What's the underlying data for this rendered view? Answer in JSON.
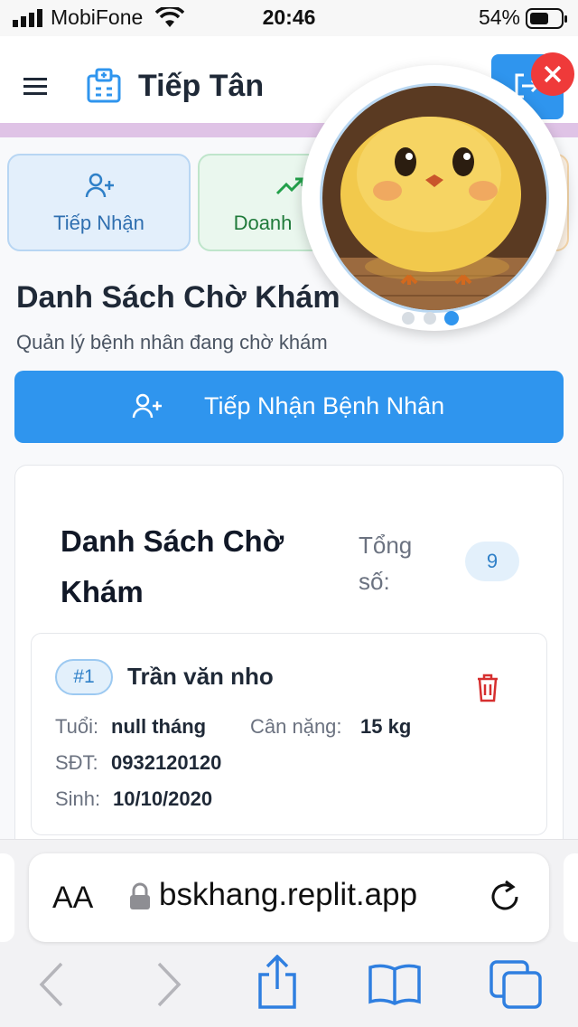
{
  "status_bar": {
    "carrier": "MobiFone",
    "time": "20:46",
    "battery": "54%"
  },
  "header": {
    "title": "Tiếp Tân"
  },
  "tabs": [
    {
      "label": "Tiếp Nhận",
      "icon": "user-plus-icon"
    },
    {
      "label": "Doanh",
      "icon": "trending-up-icon"
    }
  ],
  "page": {
    "title": "Danh Sách Chờ Khám",
    "subtitle": "Quản lý bệnh nhân đang chờ khám",
    "primary_button": "Tiếp Nhận Bệnh Nhân"
  },
  "waiting_list": {
    "title": "Danh Sách Chờ Khám",
    "total_label": "Tổng số:",
    "total_value": "9",
    "patients": [
      {
        "number": "#1",
        "name": "Trần văn nho",
        "age_label": "Tuổi:",
        "age": "null tháng",
        "weight_label": "Cân nặng:",
        "weight": "15 kg",
        "phone_label": "SĐT:",
        "phone": "0932120120",
        "dob_label": "Sinh:",
        "dob": "10/10/2020"
      }
    ]
  },
  "browser": {
    "aa_label": "AA",
    "url": "bskhang.replit.app"
  },
  "colors": {
    "primary": "#2f95ee",
    "accent_bar": "#dfc3e6",
    "danger": "#d62f2f",
    "close": "#ef3a3a"
  }
}
